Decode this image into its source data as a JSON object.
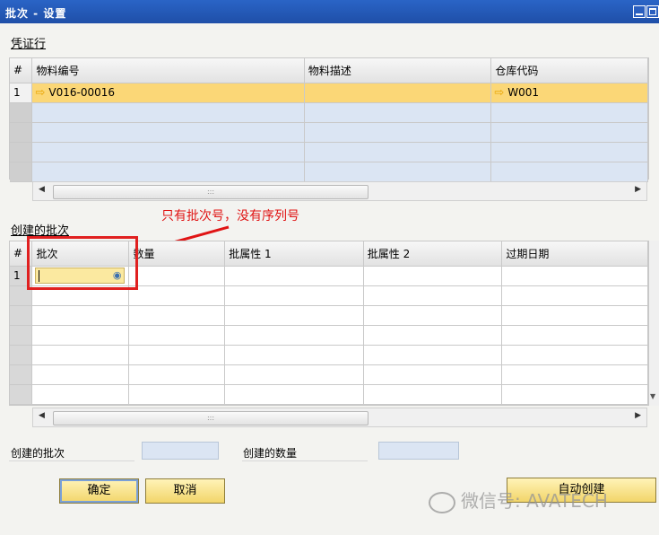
{
  "window": {
    "title": "批次 - 设置"
  },
  "voucher": {
    "section_label": "凭证行",
    "columns": [
      "#",
      "物料编号",
      "物料描述",
      "仓库代码"
    ],
    "rows": [
      {
        "num": "1",
        "item_no": "V016-00016",
        "desc": "",
        "warehouse": "W001"
      }
    ]
  },
  "batches": {
    "section_label": "创建的批次",
    "columns": [
      "#",
      "批次",
      "数量",
      "批属性 1",
      "批属性 2",
      "过期日期"
    ],
    "rows": [
      {
        "num": "1"
      }
    ]
  },
  "annotation": {
    "text": "只有批次号，没有序列号",
    "color": "#e01414"
  },
  "footer": {
    "created_batches_label": "创建的批次",
    "created_qty_label": "创建的数量",
    "created_batches_value": "",
    "created_qty_value": ""
  },
  "buttons": {
    "ok": "确定",
    "cancel": "取消",
    "auto_create": "自动创建"
  },
  "watermark": "微信号: AVATECH",
  "colors": {
    "title_bar": "#2a64c6",
    "selected_row": "#fbd777",
    "empty_row": "#dbe5f3",
    "button": "#f2d569"
  }
}
